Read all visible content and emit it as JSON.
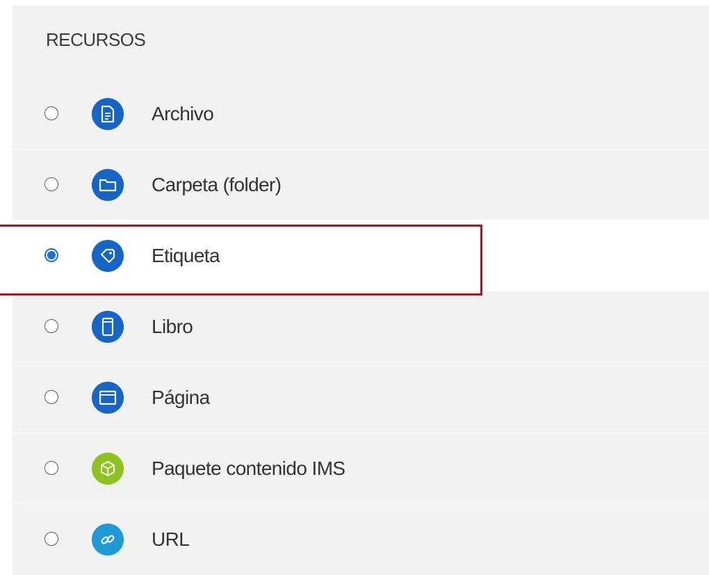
{
  "section": {
    "title": "RECURSOS"
  },
  "options": [
    {
      "label": "Archivo",
      "icon": "file-icon",
      "icon_color": "#1565c8",
      "selected": false
    },
    {
      "label": "Carpeta (folder)",
      "icon": "folder-icon",
      "icon_color": "#1565c8",
      "selected": false
    },
    {
      "label": "Etiqueta",
      "icon": "tag-icon",
      "icon_color": "#1565c8",
      "selected": true
    },
    {
      "label": "Libro",
      "icon": "book-icon",
      "icon_color": "#1565c8",
      "selected": false
    },
    {
      "label": "Página",
      "icon": "page-icon",
      "icon_color": "#1565c8",
      "selected": false
    },
    {
      "label": "Paquete contenido IMS",
      "icon": "package-icon",
      "icon_color": "#8dc21f",
      "selected": false
    },
    {
      "label": "URL",
      "icon": "link-icon",
      "icon_color": "#1e9ad6",
      "selected": false
    }
  ],
  "colors": {
    "highlight_border": "#b3131b",
    "radio_checked": "#1f6fe0",
    "panel_background": "#f2f2f2"
  }
}
